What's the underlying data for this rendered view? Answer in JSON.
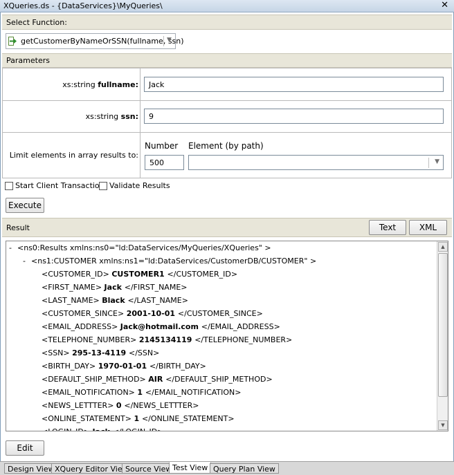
{
  "window": {
    "title": "XQueries.ds - {DataServices}\\MyQueries\\",
    "close_glyph": "✕"
  },
  "select_function": {
    "header": "Select Function:",
    "selected": "getCustomerByNameOrSSN(fullname, ssn)"
  },
  "parameters": {
    "header": "Parameters",
    "fullname": {
      "type": "xs:string",
      "name": "fullname:",
      "value": "Jack"
    },
    "ssn": {
      "type": "xs:string",
      "name": "ssn:",
      "value": "9"
    },
    "limit": {
      "label": "Limit elements in array results to:",
      "number_label": "Number",
      "element_label": "Element (by path)",
      "number_value": "500",
      "element_value": ""
    }
  },
  "options": {
    "start_client_transaction": "Start Client Transaction",
    "validate_results": "Validate Results"
  },
  "execute_label": "Execute",
  "result": {
    "header": "Result",
    "text_button": "Text",
    "xml_button": "XML",
    "lines": [
      {
        "toggle": "-",
        "pre": "<ns0:Results xmlns:ns0=\"ld:DataServices/MyQueries/XQueries\" >",
        "val": "",
        "post": ""
      },
      {
        "toggle": "-",
        "pre": "<ns1:CUSTOMER xmlns:ns1=\"ld:DataServices/CustomerDB/CUSTOMER\" >",
        "val": "",
        "post": ""
      },
      {
        "toggle": "",
        "pre": "<CUSTOMER_ID>",
        "val": "CUSTOMER1",
        "post": "</CUSTOMER_ID>"
      },
      {
        "toggle": "",
        "pre": "<FIRST_NAME>",
        "val": "Jack",
        "post": "</FIRST_NAME>"
      },
      {
        "toggle": "",
        "pre": "<LAST_NAME>",
        "val": "Black",
        "post": "</LAST_NAME>"
      },
      {
        "toggle": "",
        "pre": "<CUSTOMER_SINCE>",
        "val": "2001-10-01",
        "post": "</CUSTOMER_SINCE>"
      },
      {
        "toggle": "",
        "pre": "<EMAIL_ADDRESS>",
        "val": "Jack@hotmail.com",
        "post": "</EMAIL_ADDRESS>"
      },
      {
        "toggle": "",
        "pre": "<TELEPHONE_NUMBER>",
        "val": "2145134119",
        "post": "</TELEPHONE_NUMBER>"
      },
      {
        "toggle": "",
        "pre": "<SSN>",
        "val": "295-13-4119",
        "post": "</SSN>"
      },
      {
        "toggle": "",
        "pre": "<BIRTH_DAY>",
        "val": "1970-01-01",
        "post": "</BIRTH_DAY>"
      },
      {
        "toggle": "",
        "pre": "<DEFAULT_SHIP_METHOD>",
        "val": "AIR",
        "post": "</DEFAULT_SHIP_METHOD>"
      },
      {
        "toggle": "",
        "pre": "<EMAIL_NOTIFICATION>",
        "val": "1",
        "post": "</EMAIL_NOTIFICATION>"
      },
      {
        "toggle": "",
        "pre": "<NEWS_LETTTER>",
        "val": "0",
        "post": "</NEWS_LETTTER>"
      },
      {
        "toggle": "",
        "pre": "<ONLINE_STATEMENT>",
        "val": "1",
        "post": "</ONLINE_STATEMENT>"
      },
      {
        "toggle": "",
        "pre": "<LOGIN_ID>",
        "val": "Jack",
        "post": "</LOGIN_ID>"
      }
    ]
  },
  "edit_label": "Edit",
  "tabs": [
    "Design View",
    "XQuery Editor View",
    "Source View",
    "Test View",
    "Query Plan View"
  ],
  "active_tab": "Test View"
}
